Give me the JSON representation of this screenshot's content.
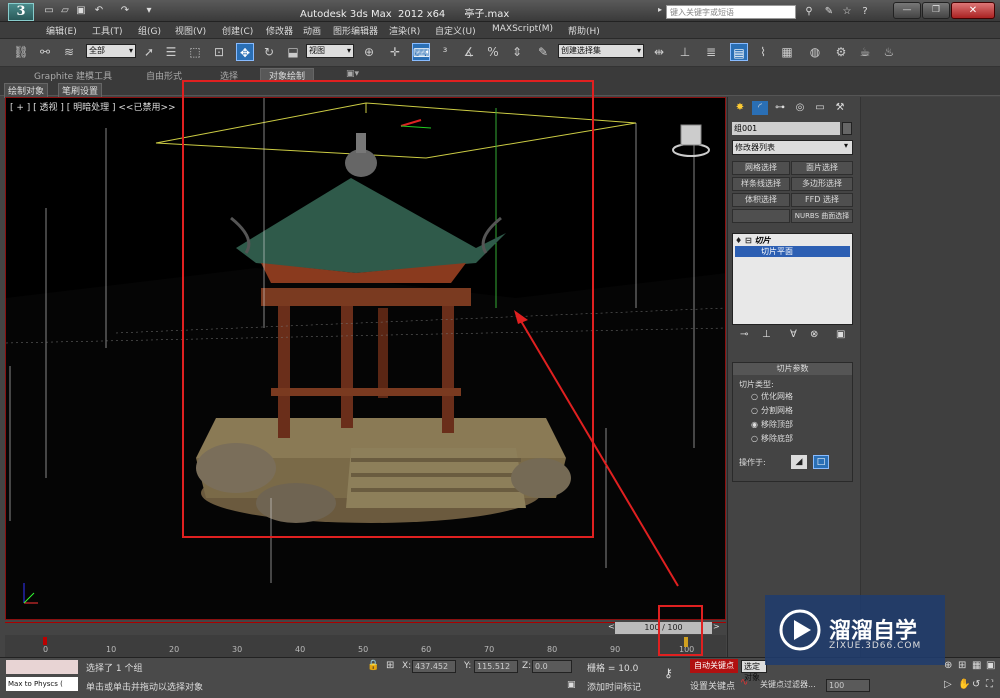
{
  "title_bar": {
    "window_title": "Autodesk 3ds Max  2012 x64      亭子.max",
    "search_placeholder": "键入关键字或短语",
    "app_logo": "3"
  },
  "menu": [
    "编辑(E)",
    "工具(T)",
    "组(G)",
    "视图(V)",
    "创建(C)",
    "修改器",
    "动画",
    "图形编辑器",
    "渲染(R)",
    "自定义(U)",
    "MAXScript(M)",
    "帮助(H)"
  ],
  "toolbar": {
    "selection_filter": "全部",
    "ref_coord": "视图",
    "named_selection": "创建选择集"
  },
  "ribbon_tabs": [
    "Graphite 建模工具",
    "自由形式",
    "选择",
    "对象绘制"
  ],
  "ribbon_active": "对象绘制",
  "sub_tabs": [
    "绘制对象",
    "笔刷设置"
  ],
  "viewport": {
    "label": "[ + ] [ 透视 ] [ 明暗处理 ] <<已禁用>>"
  },
  "timeline": {
    "slider_text": "100 / 100",
    "ticks": [
      "0",
      "10",
      "20",
      "30",
      "40",
      "50",
      "60",
      "70",
      "80",
      "90",
      "100"
    ]
  },
  "command_panel": {
    "object_name": "组001",
    "modifier_list": "修改器列表",
    "mod_buttons": [
      "网格选择",
      "面片选择",
      "样条线选择",
      "多边形选择",
      "体积选择",
      "FFD 选择",
      "NURBS 曲面选择"
    ],
    "stack": [
      "切片",
      "切片平面"
    ],
    "rollout_title": "切片参数",
    "slice_type_label": "切片类型:",
    "slice_options": [
      "优化网格",
      "分割网格",
      "移除顶部",
      "移除底部"
    ],
    "slice_selected": "移除顶部",
    "operate_on": "操作于:"
  },
  "status": {
    "maxscript": "Max to Physcs (",
    "selection": "选择了 1 个组",
    "prompt": "单击或单击并拖动以选择对象",
    "x_label": "X:",
    "x_value": "437.452",
    "y_label": "Y:",
    "y_value": "115.512",
    "z_label": "Z:",
    "z_value": "0.0",
    "grid": "栅格 = 10.0",
    "auto_key": "自动关键点",
    "set_key": "设置关键点",
    "add_tag": "添加时间标记",
    "selected_set": "选定对象",
    "key_filters": "关键点过滤器...",
    "frame": "100"
  },
  "watermark": {
    "title": "溜溜自学",
    "subtitle": "ZIXUE.3D66.COM"
  },
  "colors": {
    "highlight": "#e02020",
    "selection_blue": "#2c5fb3",
    "viewport_bg": "#000000"
  }
}
